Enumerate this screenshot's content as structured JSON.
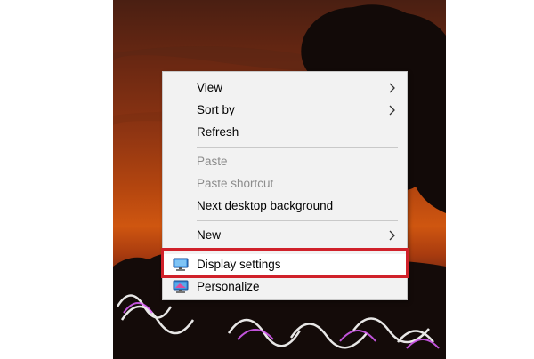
{
  "colors": {
    "menu_background": "#f2f2f2",
    "text_enabled": "#000000",
    "text_disabled": "#8c8c8c",
    "highlight_border": "#d0212a"
  },
  "context_menu": {
    "items": [
      {
        "label": "View",
        "enabled": true,
        "has_submenu": true
      },
      {
        "label": "Sort by",
        "enabled": true,
        "has_submenu": true
      },
      {
        "label": "Refresh",
        "enabled": true,
        "has_submenu": false
      },
      {
        "label": "Paste",
        "enabled": false,
        "has_submenu": false
      },
      {
        "label": "Paste shortcut",
        "enabled": false,
        "has_submenu": false
      },
      {
        "label": "Next desktop background",
        "enabled": true,
        "has_submenu": false
      },
      {
        "label": "New",
        "enabled": true,
        "has_submenu": true
      },
      {
        "label": "Display settings",
        "enabled": true,
        "has_submenu": false,
        "icon": "monitor-icon",
        "highlighted": true
      },
      {
        "label": "Personalize",
        "enabled": true,
        "has_submenu": false,
        "icon": "personalize-monitor-icon"
      }
    ]
  }
}
